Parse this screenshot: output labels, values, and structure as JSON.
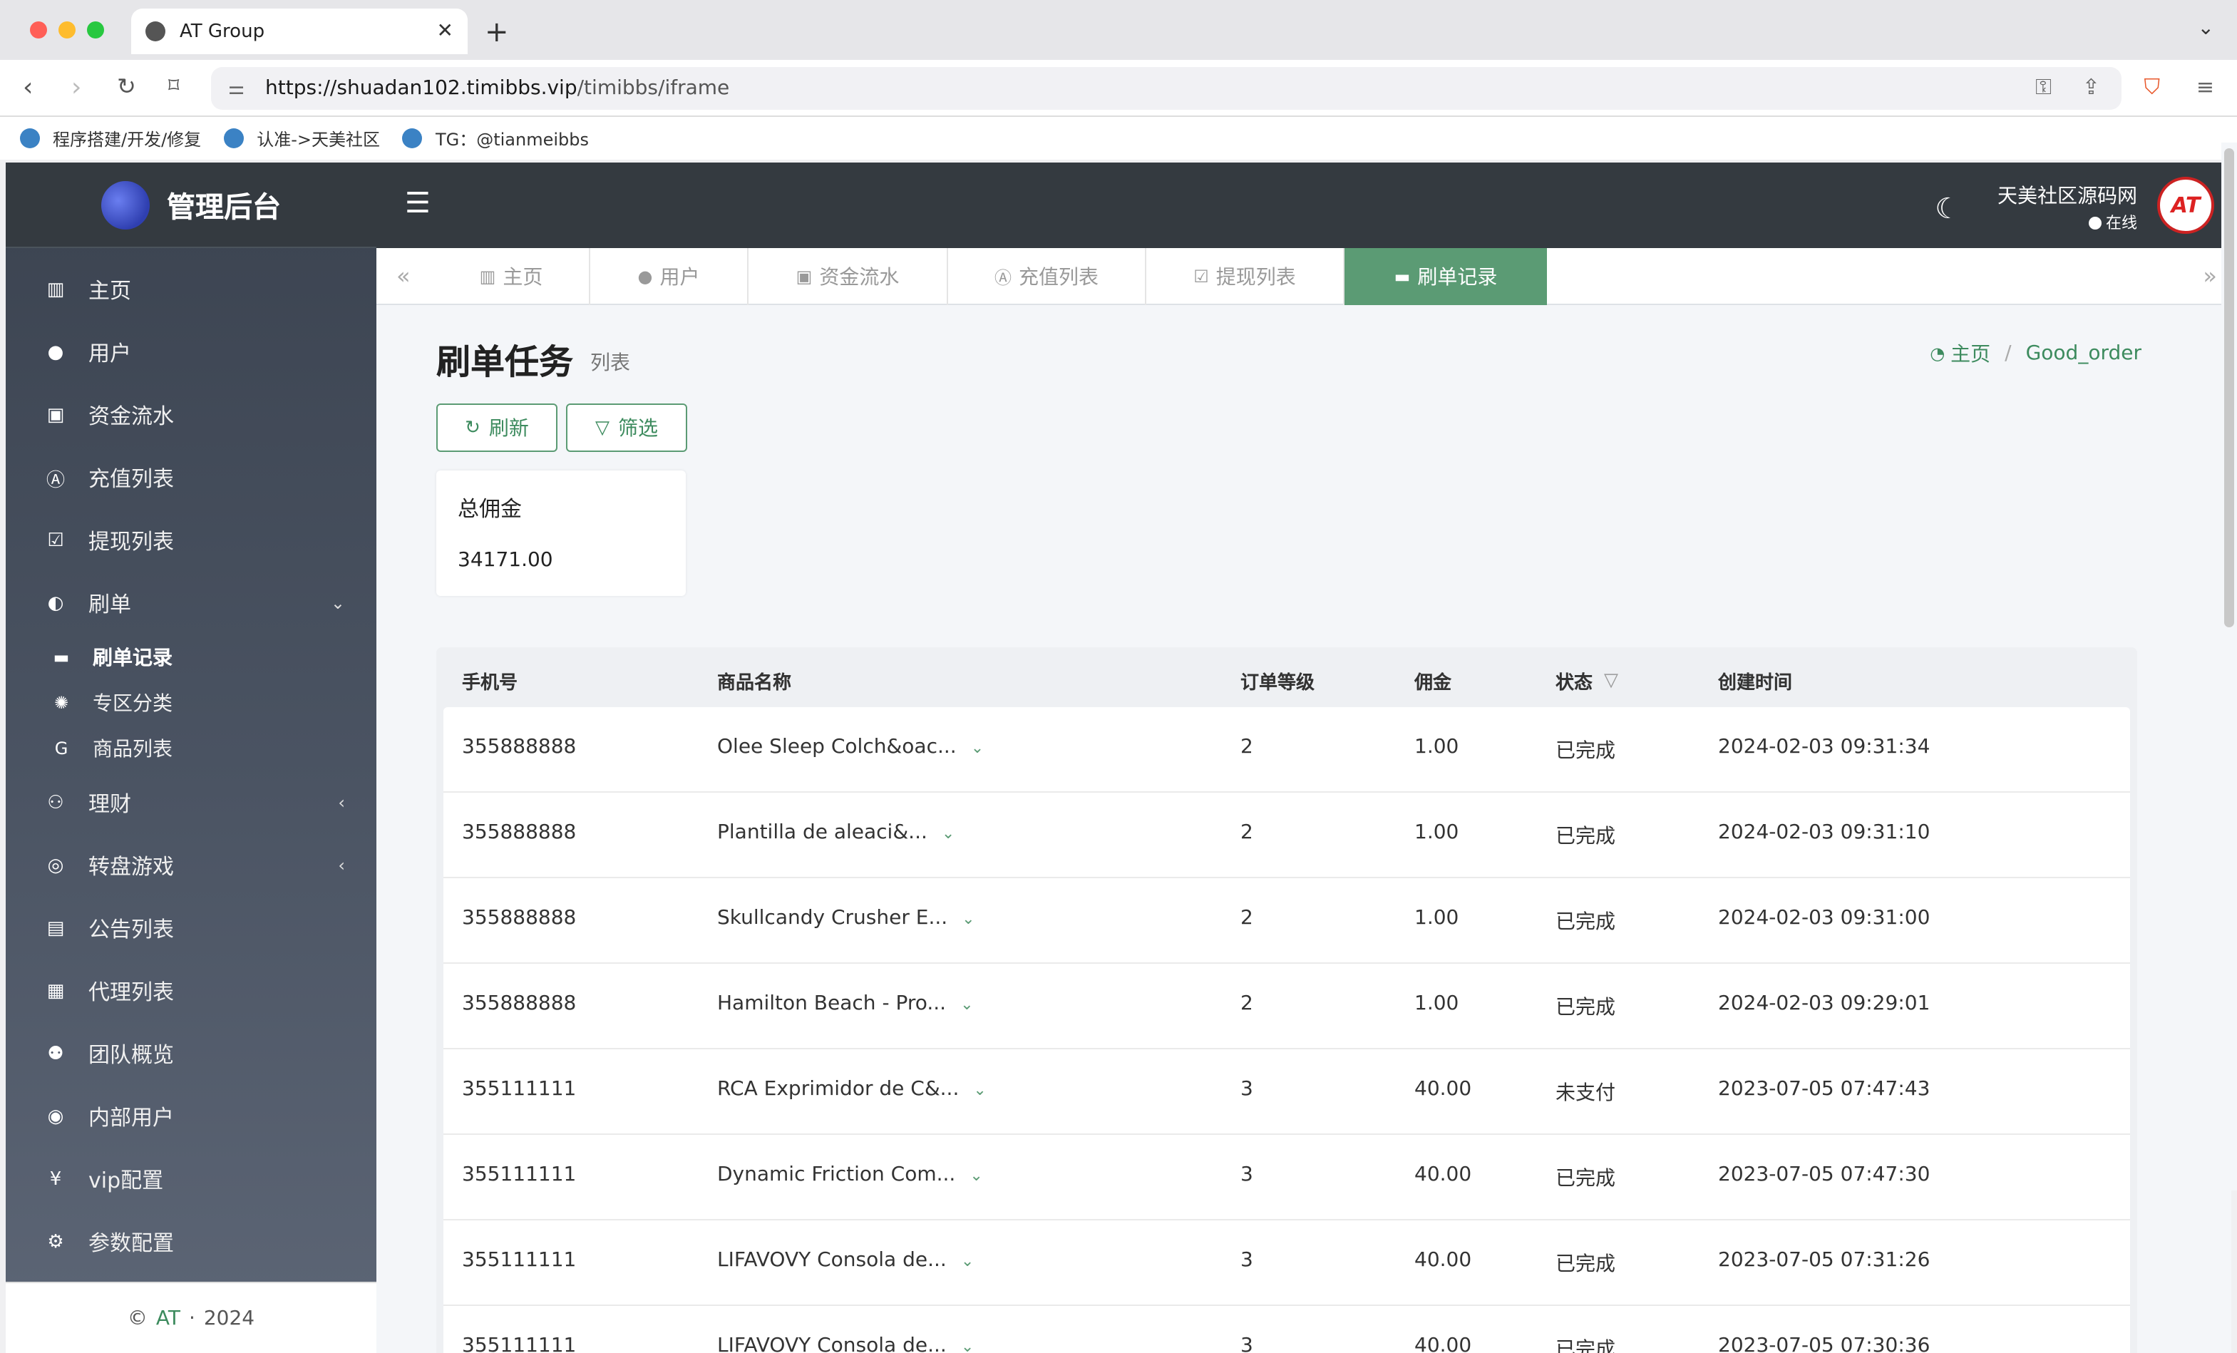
{
  "browser": {
    "tab_title": "AT Group",
    "url_host": "https://shuadan102.timibbs.vip",
    "url_path": "/timibbs/iframe",
    "bookmarks": [
      {
        "label": "程序搭建/开发/修复"
      },
      {
        "label": "认准->天美社区"
      },
      {
        "label": "TG：@tianmeibbs"
      }
    ]
  },
  "sidebar": {
    "brand": "管理后台",
    "items": [
      {
        "label": "主页",
        "icon": "bar-chart-icon"
      },
      {
        "label": "用户",
        "icon": "user-icon"
      },
      {
        "label": "资金流水",
        "icon": "money-icon"
      },
      {
        "label": "充值列表",
        "icon": "a-box-icon"
      },
      {
        "label": "提现列表",
        "icon": "check-square-icon"
      },
      {
        "label": "刷单",
        "icon": "half-circle-icon",
        "expanded": true
      }
    ],
    "sub_items": [
      {
        "label": "刷单记录",
        "icon": "keyboard-icon",
        "active": true
      },
      {
        "label": "专区分类",
        "icon": "cog-icon"
      },
      {
        "label": "商品列表",
        "icon": "g-icon"
      }
    ],
    "items2": [
      {
        "label": "理财",
        "icon": "chart-person-icon"
      },
      {
        "label": "转盘游戏",
        "icon": "gamepad-icon"
      },
      {
        "label": "公告列表",
        "icon": "document-icon"
      },
      {
        "label": "代理列表",
        "icon": "contact-icon"
      },
      {
        "label": "团队概览",
        "icon": "users-icon"
      },
      {
        "label": "内部用户",
        "icon": "user-circle-icon"
      },
      {
        "label": "vip配置",
        "icon": "yen-icon"
      },
      {
        "label": "参数配置",
        "icon": "cogs-icon"
      }
    ],
    "footer": {
      "copyright": "©",
      "brand": "AT",
      "dot": "·",
      "year": "2024"
    }
  },
  "topbar": {
    "user_name": "天美社区源码网",
    "user_status": "在线",
    "avatar_text": "AT"
  },
  "page_tabs": [
    {
      "label": "主页",
      "icon": "bar-chart-icon"
    },
    {
      "label": "用户",
      "icon": "user-icon"
    },
    {
      "label": "资金流水",
      "icon": "money-icon"
    },
    {
      "label": "充值列表",
      "icon": "a-box-icon"
    },
    {
      "label": "提现列表",
      "icon": "check-square-icon"
    },
    {
      "label": "刷单记录",
      "icon": "keyboard-icon",
      "active": true
    }
  ],
  "page": {
    "title": "刷单任务",
    "subtitle": "列表",
    "breadcrumb_home": "主页",
    "breadcrumb_sep": "/",
    "breadcrumb_current": "Good_order",
    "refresh_label": "刷新",
    "filter_label": "筛选",
    "stat_label": "总佣金",
    "stat_value": "34171.00"
  },
  "table": {
    "headers": [
      "手机号",
      "商品名称",
      "订单等级",
      "佣金",
      "状态",
      "创建时间"
    ],
    "rows": [
      {
        "phone": "355888888",
        "product": "Olee Sleep Colch&oac...",
        "level": "2",
        "commission": "1.00",
        "status": "已完成",
        "created": "2024-02-03 09:31:34"
      },
      {
        "phone": "355888888",
        "product": "Plantilla de aleaci&...",
        "level": "2",
        "commission": "1.00",
        "status": "已完成",
        "created": "2024-02-03 09:31:10"
      },
      {
        "phone": "355888888",
        "product": "Skullcandy Crusher E...",
        "level": "2",
        "commission": "1.00",
        "status": "已完成",
        "created": "2024-02-03 09:31:00"
      },
      {
        "phone": "355888888",
        "product": "Hamilton Beach - Pro...",
        "level": "2",
        "commission": "1.00",
        "status": "已完成",
        "created": "2024-02-03 09:29:01"
      },
      {
        "phone": "355111111",
        "product": "RCA Exprimidor de C&...",
        "level": "3",
        "commission": "40.00",
        "status": "未支付",
        "created": "2023-07-05 07:47:43"
      },
      {
        "phone": "355111111",
        "product": "Dynamic Friction Com...",
        "level": "3",
        "commission": "40.00",
        "status": "已完成",
        "created": "2023-07-05 07:47:30"
      },
      {
        "phone": "355111111",
        "product": "LIFAVOVY Consola de...",
        "level": "3",
        "commission": "40.00",
        "status": "已完成",
        "created": "2023-07-05 07:31:26"
      },
      {
        "phone": "355111111",
        "product": "LIFAVOVY Consola de...",
        "level": "3",
        "commission": "40.00",
        "status": "已完成",
        "created": "2023-07-05 07:30:36"
      }
    ]
  },
  "colors": {
    "accent": "#5b9b74",
    "sidebar": "#3b4350",
    "topbar": "#343a40"
  }
}
